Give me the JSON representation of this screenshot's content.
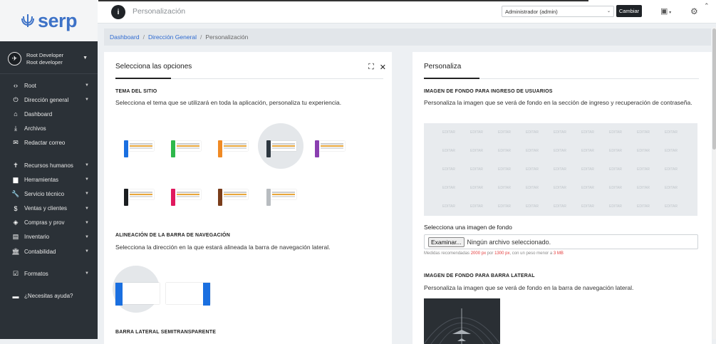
{
  "brand": {
    "name": "serp"
  },
  "user": {
    "name": "Root Developer",
    "role": "Root developer"
  },
  "menu": [
    {
      "label": "Root",
      "icon": "code-icon",
      "caret": true
    },
    {
      "label": "Dirección general",
      "icon": "power-icon",
      "caret": true
    },
    {
      "label": "Dashboard",
      "icon": "home-icon",
      "caret": false
    },
    {
      "label": "Archivos",
      "icon": "download-icon",
      "caret": false
    },
    {
      "label": "Redactar correo",
      "icon": "mail-icon",
      "caret": false
    },
    {
      "label": "Recursos humanos",
      "icon": "person-icon",
      "caret": true
    },
    {
      "label": "Herramientas",
      "icon": "briefcase-icon",
      "caret": true
    },
    {
      "label": "Servicio técnico",
      "icon": "wrench-icon",
      "caret": true
    },
    {
      "label": "Ventas y clientes",
      "icon": "dollar-icon",
      "caret": true
    },
    {
      "label": "Compras y prov",
      "icon": "tag-icon",
      "caret": true
    },
    {
      "label": "Inventario",
      "icon": "inbox-icon",
      "caret": true
    },
    {
      "label": "Contabilidad",
      "icon": "bank-icon",
      "caret": true
    },
    {
      "label": "Formatos",
      "icon": "checkbox-icon",
      "caret": true
    },
    {
      "label": "¿Necesitas ayuda?",
      "icon": "chat-icon",
      "caret": false
    }
  ],
  "topbar": {
    "page_name": "Personalización",
    "role_select": "Administrador (admin)",
    "change_button": "Cambiar"
  },
  "breadcrumb": [
    "Dashboard",
    "Dirección General",
    "Personalización"
  ],
  "left_panel": {
    "title": "Selecciona las opciones",
    "theme_heading": "TEMA DEL SITIO",
    "theme_desc": "Selecciona el tema que se utilizará en toda la aplicación, personaliza tu experiencia.",
    "themes": [
      {
        "color": "#1a6fe0",
        "selected": false
      },
      {
        "color": "#2eb84b",
        "selected": false
      },
      {
        "color": "#f08a24",
        "selected": false
      },
      {
        "color": "#2d3740",
        "selected": true
      },
      {
        "color": "#8a3fb0",
        "selected": false
      },
      {
        "color": "#1b1e21",
        "selected": false
      },
      {
        "color": "#e0195e",
        "selected": false
      },
      {
        "color": "#7a3d1b",
        "selected": false
      },
      {
        "color": "#b8bcc0",
        "selected": false
      }
    ],
    "nav_heading": "ALINEACIÓN DE LA BARRA DE NAVEGACIÓN",
    "nav_desc": "Selecciona la dirección en la que estará alineada la barra de navegación lateral.",
    "semi_heading": "BARRA LATERAL SEMITRANSPARENTE"
  },
  "right_panel": {
    "title": "Personaliza",
    "login_bg_heading": "IMAGEN DE FONDO PARA INGRESO DE USUARIOS",
    "login_bg_desc": "Personaliza la imagen que se verá de fondo en la sección de ingreso y recuperación de contraseña.",
    "edit_tile": "EDITAR",
    "file_label": "Selecciona una imagen de fondo",
    "file_button": "Examinar...",
    "file_status": "Ningún archivo seleccionado.",
    "help_pre": "Medidas recomendadas",
    "help_w": "2000 px",
    "help_por": "por",
    "help_h": "1300 px",
    "help_mid": ", con un peso menor a",
    "help_size": "3 MB",
    "sidebar_bg_heading": "IMAGEN DE FONDO PARA BARRA LATERAL",
    "sidebar_bg_desc": "Personaliza la imagen que se verá de fondo en la barra de navegación lateral."
  }
}
